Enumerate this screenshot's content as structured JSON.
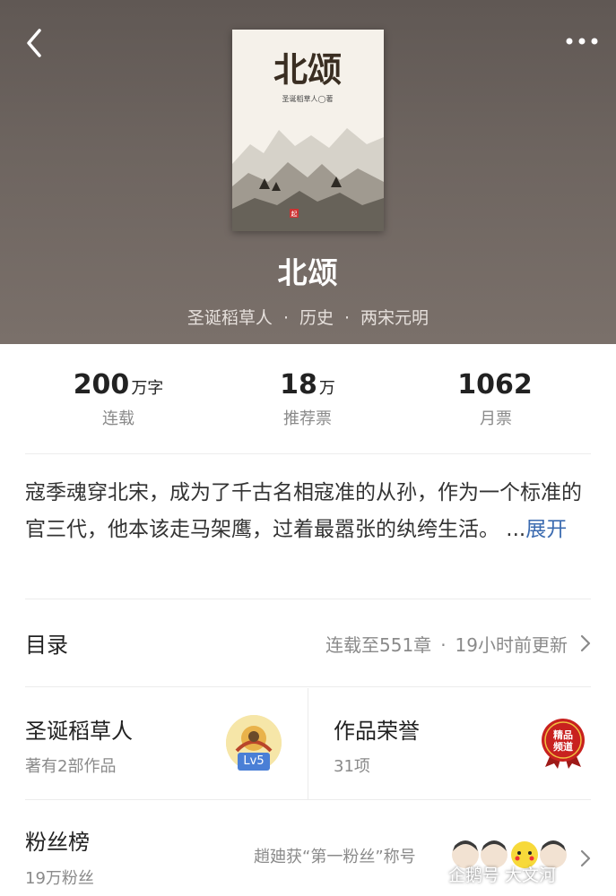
{
  "book": {
    "title": "北颂",
    "cover_title": "北颂",
    "cover_author": "圣诞稻草人◯著",
    "cover_seal": "起",
    "author": "圣诞稻草人",
    "genre": "历史",
    "subgenre": "两宋元明",
    "dot": "·"
  },
  "stats": [
    {
      "value": "200",
      "unit": "万字",
      "label": "连载"
    },
    {
      "value": "18",
      "unit": "万",
      "label": "推荐票"
    },
    {
      "value": "1062",
      "unit": "",
      "label": "月票"
    }
  ],
  "description": {
    "text": "寇季魂穿北宋，成为了千古名相寇准的从孙，作为一个标准的官三代，他本该走马架鹰，过着最嚣张的纨绔生活。 ...",
    "expand_label": "展开"
  },
  "toc": {
    "title": "目录",
    "progress": "连载至551章",
    "dot": "·",
    "updated": "19小时前更新"
  },
  "author_card": {
    "name": "圣诞稻草人",
    "works": "著有2部作品",
    "level": "Lv5"
  },
  "honor_card": {
    "title": "作品荣誉",
    "count": "31项",
    "badge_line1": "精品",
    "badge_line2": "频道"
  },
  "fans": {
    "title": "粉丝榜",
    "count": "19万粉丝",
    "top_fan": "趙廸获“第一粉丝”称号"
  },
  "watermark": "企鹅号 大文河",
  "colors": {
    "hero_bg": "#6a615c",
    "link": "#3b6bb0",
    "level_badge": "#4a7fd6",
    "honor_red": "#c8211f"
  }
}
